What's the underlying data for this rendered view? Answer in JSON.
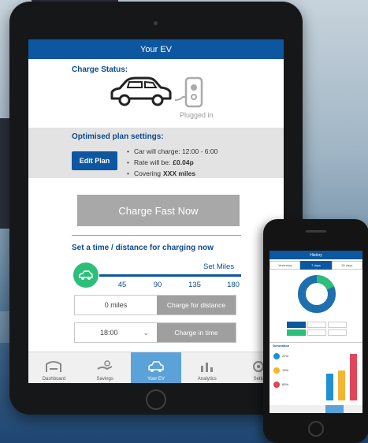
{
  "tablet": {
    "header_title": "Your EV",
    "charge_status": {
      "title": "Charge Status:",
      "plug_state": "Plugged in"
    },
    "plan_settings": {
      "title": "Optimised plan settings:",
      "edit_label": "Edit Plan",
      "items": [
        {
          "label": "Car will charge:",
          "value": "12:00 - 6:00",
          "bold": false
        },
        {
          "label": "Rate will be:",
          "value": "£0.04p",
          "bold": true
        },
        {
          "label": "Covering",
          "value": "XXX miles",
          "bold": true
        }
      ]
    },
    "charge_fast_label": "Charge Fast Now",
    "set_section": {
      "title": "Set a time / distance for charging now",
      "slider_label": "Set Miles",
      "ticks": [
        "45",
        "90",
        "135",
        "180"
      ],
      "miles_value": "0 miles",
      "distance_button": "Charge for distance",
      "time_value": "18:00",
      "time_button": "Charge in time"
    },
    "tabs": [
      {
        "label": "Dashboard",
        "icon": "dashboard-icon",
        "active": false
      },
      {
        "label": "Savings",
        "icon": "savings-icon",
        "active": false
      },
      {
        "label": "Your EV",
        "icon": "ev-car-icon",
        "active": true
      },
      {
        "label": "Analytics",
        "icon": "analytics-icon",
        "active": false
      },
      {
        "label": "Setti",
        "icon": "settings-icon",
        "active": false
      }
    ]
  },
  "phone": {
    "header_title": "History",
    "period_tabs": [
      "Yesterday",
      "7 days",
      "30 days"
    ],
    "active_period": "7 days",
    "section_title": "Generation",
    "breakdown": [
      {
        "value": "22%",
        "color": "#1f8fd6"
      },
      {
        "value": "13%",
        "color": "#f2b632"
      },
      {
        "value": "65%",
        "color": "#e0475b"
      }
    ],
    "bars": [
      {
        "color": "#1f8fd6",
        "value": 0.55
      },
      {
        "color": "#f2b632",
        "value": 0.62
      },
      {
        "color": "#e0475b",
        "value": 0.95
      }
    ]
  },
  "colors": {
    "primary": "#0d57a1",
    "accent_green": "#2cbf79",
    "button_gray": "#a8a8a8",
    "active_tab": "#5aa2d8"
  }
}
